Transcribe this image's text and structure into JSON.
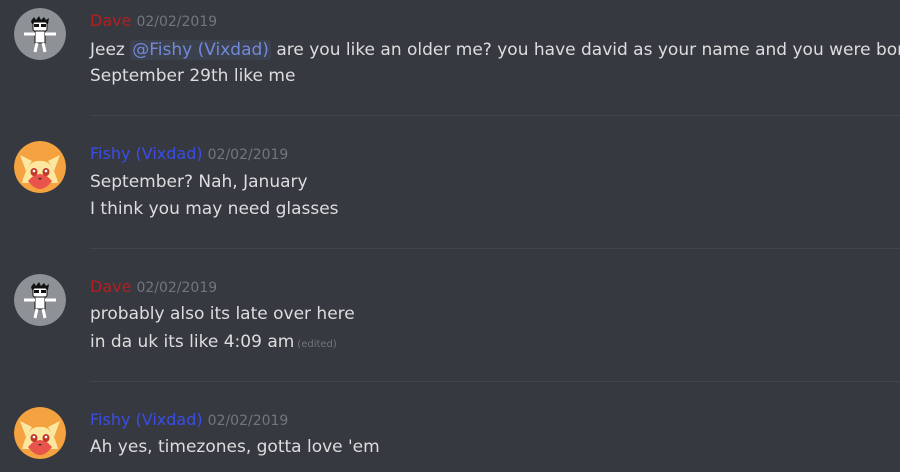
{
  "colors": {
    "background": "#36393f",
    "dave_name": "#b51f1f",
    "fishy_name": "#3b4de6",
    "text": "#dcddde",
    "timestamp": "#72767d",
    "mention": "#7289da"
  },
  "messages": [
    {
      "author": "Dave",
      "timestamp": "02/02/2019",
      "avatar_icon": "stick-figure-avatar",
      "lines": [
        {
          "before": "Jeez ",
          "mention": "@Fishy (Vixdad)",
          "after": " are you like an older me? you have david as your name and you were born"
        },
        {
          "text": "September 29th like me"
        }
      ]
    },
    {
      "author": "Fishy (Vixdad)",
      "timestamp": "02/02/2019",
      "avatar_icon": "fox-avatar",
      "lines": [
        {
          "text": "September? Nah, January"
        },
        {
          "text": "I think you may need glasses"
        }
      ]
    },
    {
      "author": "Dave",
      "timestamp": "02/02/2019",
      "avatar_icon": "stick-figure-avatar",
      "lines": [
        {
          "text": "probably also its late over here"
        },
        {
          "text": "in da uk its like 4:09 am",
          "edited": "(edited)"
        }
      ]
    },
    {
      "author": "Fishy (Vixdad)",
      "timestamp": "02/02/2019",
      "avatar_icon": "fox-avatar",
      "lines": [
        {
          "text": "Ah yes, timezones, gotta love 'em"
        }
      ]
    }
  ]
}
